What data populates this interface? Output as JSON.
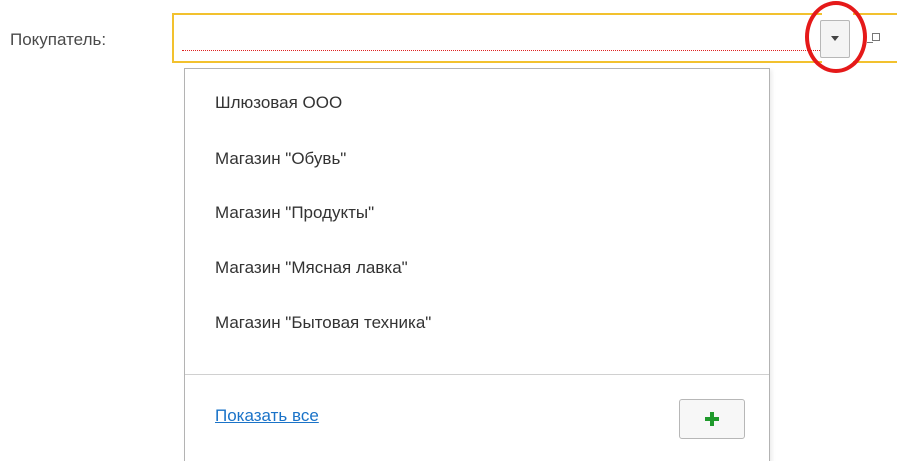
{
  "form": {
    "field_label": "Покупатель:",
    "field_value": "",
    "dropdown_icon": "chevron-down-icon",
    "open_icon": "open-form-icon",
    "accent_color": "#f2c12e",
    "highlight_color": "#e51919"
  },
  "dropdown": {
    "items": [
      {
        "label": "Шлюзовая ООО"
      },
      {
        "label": "Магазин \"Обувь\""
      },
      {
        "label": "Магазин \"Продукты\""
      },
      {
        "label": "Магазин \"Мясная лавка\""
      },
      {
        "label": "Магазин \"Бытовая техника\""
      }
    ],
    "show_all_label": "Показать все",
    "add_icon": "plus-icon",
    "add_icon_color": "#1f9a2c"
  }
}
